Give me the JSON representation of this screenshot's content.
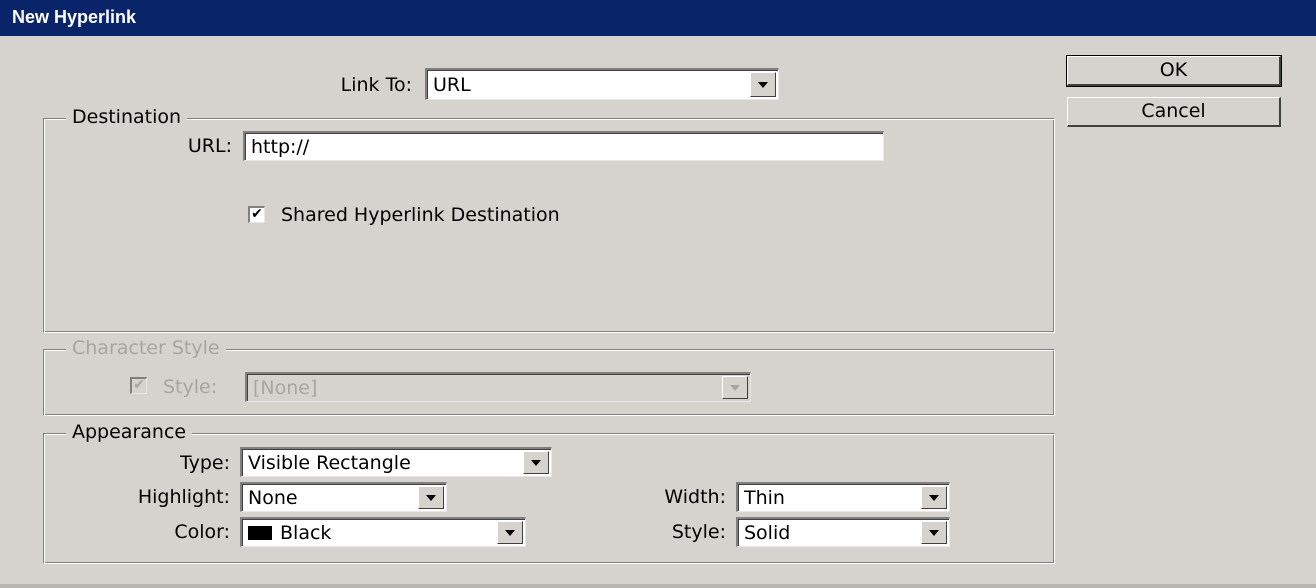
{
  "window": {
    "title": "New Hyperlink"
  },
  "link_to": {
    "label": "Link To:",
    "value": "URL"
  },
  "destination": {
    "legend": "Destination",
    "url_label": "URL:",
    "url_value": "http://",
    "shared_checkbox_label": "Shared Hyperlink Destination",
    "shared_checked": "✔"
  },
  "character_style": {
    "legend": "Character Style",
    "style_label": "Style:",
    "style_value": "[None]",
    "style_checked": "✔"
  },
  "appearance": {
    "legend": "Appearance",
    "type_label": "Type:",
    "type_value": "Visible Rectangle",
    "highlight_label": "Highlight:",
    "highlight_value": "None",
    "color_label": "Color:",
    "color_value": "Black",
    "color_swatch": "#000000",
    "width_label": "Width:",
    "width_value": "Thin",
    "style_label": "Style:",
    "style_value": "Solid"
  },
  "buttons": {
    "ok": "OK",
    "cancel": "Cancel"
  }
}
